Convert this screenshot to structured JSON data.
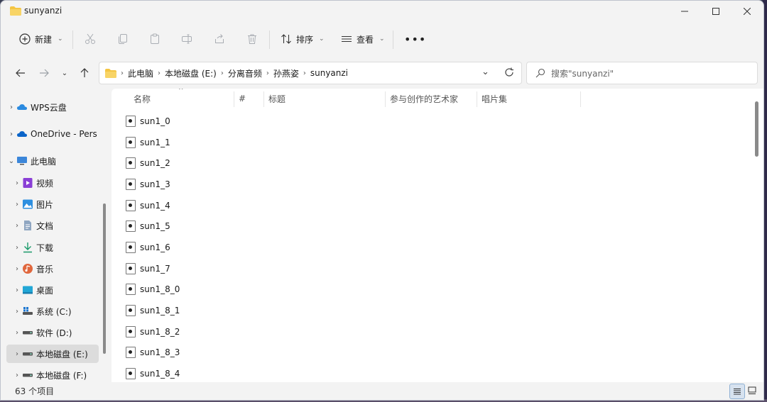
{
  "window": {
    "title": "sunyanzi"
  },
  "toolbar": {
    "new_label": "新建",
    "sort_label": "排序",
    "view_label": "查看"
  },
  "address": {
    "crumbs": [
      "此电脑",
      "本地磁盘 (E:)",
      "分离音频",
      "孙燕姿",
      "sunyanzi"
    ]
  },
  "search": {
    "placeholder": "搜索\"sunyanzi\""
  },
  "sidebar": {
    "items": [
      {
        "label": "WPS云盘"
      },
      {
        "label": "OneDrive - Pers"
      },
      {
        "label": "此电脑"
      },
      {
        "label": "视频"
      },
      {
        "label": "图片"
      },
      {
        "label": "文档"
      },
      {
        "label": "下载"
      },
      {
        "label": "音乐"
      },
      {
        "label": "桌面"
      },
      {
        "label": "系统 (C:)"
      },
      {
        "label": "软件 (D:)"
      },
      {
        "label": "本地磁盘 (E:)"
      },
      {
        "label": "本地磁盘 (F:)"
      }
    ]
  },
  "columns": [
    "名称",
    "#",
    "标题",
    "参与创作的艺术家",
    "唱片集"
  ],
  "files": [
    {
      "name": "sun1_0"
    },
    {
      "name": "sun1_1"
    },
    {
      "name": "sun1_2"
    },
    {
      "name": "sun1_3"
    },
    {
      "name": "sun1_4"
    },
    {
      "name": "sun1_5"
    },
    {
      "name": "sun1_6"
    },
    {
      "name": "sun1_7"
    },
    {
      "name": "sun1_8_0"
    },
    {
      "name": "sun1_8_1"
    },
    {
      "name": "sun1_8_2"
    },
    {
      "name": "sun1_8_3"
    },
    {
      "name": "sun1_8_4"
    }
  ],
  "status": {
    "item_count": "63 个项目"
  },
  "colors": {
    "accent": "#0067c0",
    "folder": "#f4c542",
    "selection": "#dcdcdc"
  }
}
